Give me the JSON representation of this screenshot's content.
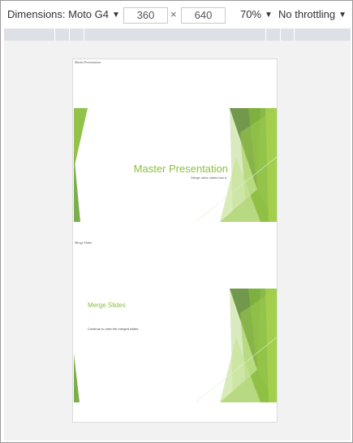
{
  "toolbar": {
    "device_label": "Dimensions: Moto G4",
    "width_value": "360",
    "times_symbol": "×",
    "height_value": "640",
    "zoom_label": "70%",
    "throttle_label": "No throttling",
    "caret": "▼"
  },
  "slides": [
    {
      "caption": "Master Presentation",
      "title": "Master Presentation",
      "subtitle": "Merge other slides into it."
    },
    {
      "caption": "Merge Slides",
      "title": "Merge Slides",
      "body": "Continue to view the merged slides."
    }
  ],
  "colors": {
    "accent_green": "#8cbf3f",
    "dark_green": "#5f8a37",
    "light_green": "#c8e29a"
  }
}
